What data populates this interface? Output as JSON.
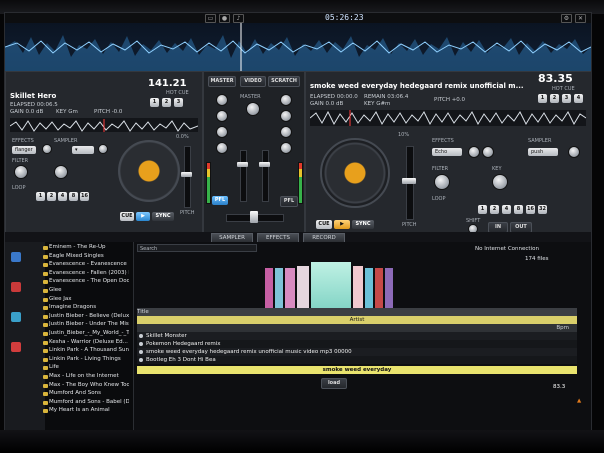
{
  "topbar": {
    "clock": "05:26:23"
  },
  "deck_left": {
    "track_title": "Skillet Hero",
    "elapsed": "ELAPSED 00:06.5",
    "gain": "GAIN 0.0 dB",
    "key": "KEY Gm",
    "pitch": "PITCH -0.0",
    "bpm": "141.21",
    "hot_cue_label": "HOT CUE",
    "effects_label": "EFFECTS",
    "sampler_label": "SAMPLER",
    "filter_label": "FILTER",
    "loop_label": "LOOP",
    "flanger_value": "flanger",
    "pitch_label": "PITCH",
    "cue_label": "CUE",
    "play_label": "▶",
    "sync_label": "SYNC",
    "pitch_pct": "0.0%",
    "loop_pads": [
      "1",
      "2",
      "4",
      "8",
      "16"
    ]
  },
  "deck_right": {
    "track_title": "smoke weed everyday hedegaard remix unofficial m...",
    "elapsed": "ELAPSED 00:00.0",
    "remain": "REMAIN 03:06.4",
    "gain": "GAIN 0.0 dB",
    "key": "KEY G#m",
    "pitch": "PITCH +0.0",
    "bpm": "83.35",
    "hot_cue_label": "HOT CUE",
    "effects_label": "EFFECTS",
    "sampler_label": "SAMPLER",
    "filter_label": "FILTER",
    "key_label": "KEY",
    "loop_label": "LOOP",
    "shift_label": "SHIFT",
    "in_label": "IN",
    "out_label": "OUT",
    "echo_value": "Echo",
    "push_value": "push",
    "pitch_pct": "10%",
    "cue_label": "CUE",
    "play_label": "▶",
    "sync_label": "SYNC",
    "pitch_label": "PITCH",
    "loop_pads": [
      "1",
      "2",
      "4",
      "8",
      "16",
      "32"
    ]
  },
  "mixer": {
    "tabs": [
      "MASTER",
      "VIDEO",
      "SCRATCH"
    ],
    "master_label": "MASTER",
    "pfl_left": "PFL",
    "pfl_right": "PFL"
  },
  "midbar": {
    "tabs": [
      "SAMPLER",
      "EFFECTS",
      "RECORD"
    ]
  },
  "browser": {
    "search_placeholder": "Search",
    "connection": "No Internet Connection",
    "file_count": "174 files",
    "folders": [
      "Eminem - The Re-Up",
      "Eagle Mixed Singles",
      "Evanescence - Evanescence (D...",
      "Evanescence - Fallen (2003) R...",
      "Evanescence - The Open Door (...",
      "Glee",
      "Glee Jax",
      "Imagine Dragons",
      "Justin Bieber - Believe (Deluxe...",
      "Justin Bieber - Under The Mistle...",
      "Justin_Bieber_-_My_World_-_Th...",
      "Kesha - Warrior (Deluxe Ed...",
      "Linkin Park - A Thousand Sun...",
      "Linkin Park - Living Things",
      "Life",
      "Max - Life on the Internet",
      "Max - The Boy Who Knew Too M...",
      "Mumford And Sons",
      "Mumford and Sons - Babel (Del...",
      "My Heart Is an Animal"
    ],
    "header_row": "Title",
    "selected_label": "Artist",
    "bpm_header": "Bpm",
    "tracks": [
      "Skillet Monster",
      "Pokemon Hedegaard remix",
      "smoke weed everyday hedegaard remix unofficial music video mp3 00000",
      "Bootleg Eh 3 Dont Hi Bea"
    ],
    "highlighted_track": "smoke weed everyday",
    "bpm_value": "83.3",
    "load_label": "load"
  }
}
